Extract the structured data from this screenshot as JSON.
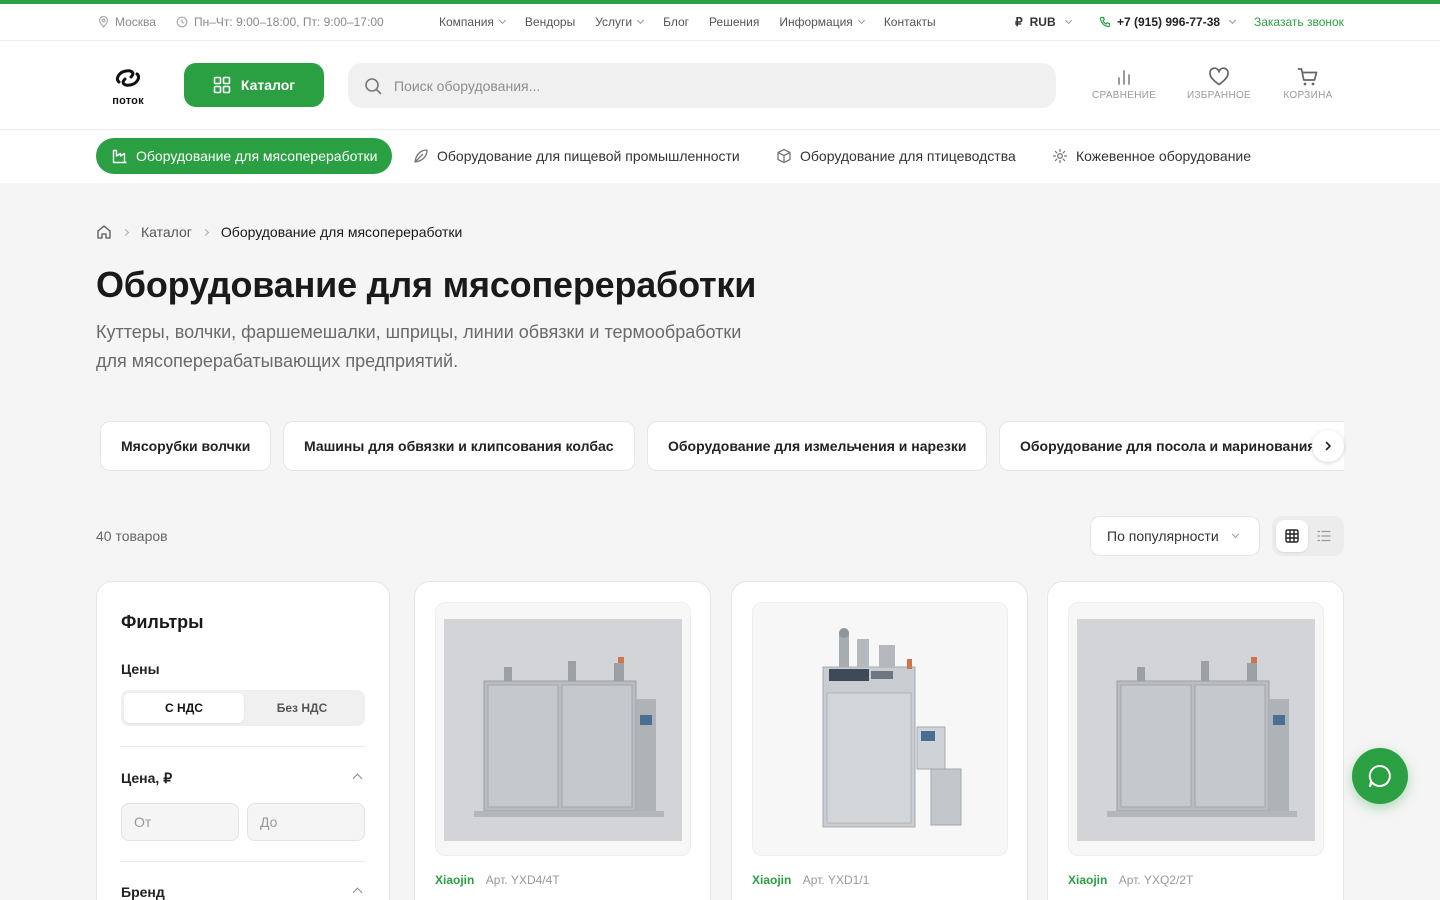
{
  "topbar": {
    "city": "Москва",
    "hours": "Пн–Чт: 9:00–18:00, Пт: 9:00–17:00",
    "nav": [
      "Компания",
      "Вендоры",
      "Услуги",
      "Блог",
      "Решения",
      "Информация",
      "Контакты"
    ],
    "currency": "RUB",
    "currency_symbol": "₽",
    "phone": "+7 (915) 996-77-38",
    "callback": "Заказать звонок"
  },
  "header": {
    "logo_text": "поток",
    "catalog_label": "Каталог",
    "search_placeholder": "Поиск оборудования...",
    "compare_label": "СРАВНЕНИЕ",
    "favorites_label": "ИЗБРАННОЕ",
    "cart_label": "КОРЗИНА"
  },
  "category_nav": [
    {
      "label": "Оборудование для мясопереработки",
      "icon": "factory-icon",
      "active": true
    },
    {
      "label": "Оборудование для пищевой промышленности",
      "icon": "leaf-icon",
      "active": false
    },
    {
      "label": "Оборудование для птицеводства",
      "icon": "box-icon",
      "active": false
    },
    {
      "label": "Кожевенное оборудование",
      "icon": "gear-icon",
      "active": false
    }
  ],
  "breadcrumb": {
    "home_icon": "home-icon",
    "items": [
      "Каталог",
      "Оборудование для мясопереработки"
    ]
  },
  "page": {
    "title": "Оборудование для мясопереработки",
    "subtitle_line1": "Куттеры, волчки, фаршемешалки, шприцы, линии обвязки и термообработки",
    "subtitle_line2": "для мясоперерабатывающих предприятий."
  },
  "subcategories": [
    "Мясорубки волчки",
    "Машины для обвязки и клипсования колбас",
    "Оборудование для измельчения и нарезки",
    "Оборудование для посола и маринования"
  ],
  "toolbar": {
    "count": "40 товаров",
    "sort_label": "По популярности"
  },
  "filters": {
    "title": "Фильтры",
    "prices_label": "Цены",
    "with_vat": "С НДС",
    "without_vat": "Без НДС",
    "price_label": "Цена, ₽",
    "from_placeholder": "От",
    "to_placeholder": "До",
    "brand_label": "Бренд"
  },
  "products": [
    {
      "brand": "Xiaojin",
      "sku": "Арт. YXD4/4T"
    },
    {
      "brand": "Xiaojin",
      "sku": "Арт. YXD1/1"
    },
    {
      "brand": "Xiaojin",
      "sku": "Арт. YXQ2/2T"
    }
  ],
  "colors": {
    "accent": "#2ba043",
    "background": "#f5f5f5"
  }
}
